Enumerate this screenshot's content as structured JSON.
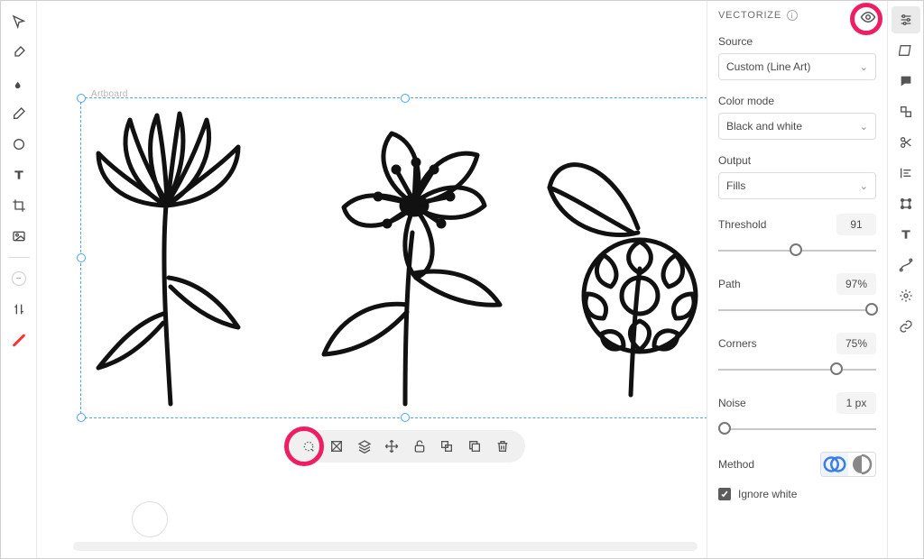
{
  "canvas": {
    "artboard_label": "Artboard"
  },
  "left_toolbar": {
    "tools": [
      "move-tool",
      "brush-tool",
      "fill-tool",
      "eraser-tool",
      "shape-tool",
      "text-tool",
      "crop-tool",
      "image-tool"
    ],
    "misc": [
      "minus-tool",
      "adjust-tool",
      "line-tool"
    ]
  },
  "context_bar": {
    "items": [
      "vectorize-action",
      "mask-action",
      "layers-action",
      "move-action",
      "unlock-action",
      "group-action",
      "duplicate-action",
      "delete-action"
    ]
  },
  "panel": {
    "title": "VECTORIZE",
    "source_label": "Source",
    "source_value": "Custom (Line Art)",
    "colormode_label": "Color mode",
    "colormode_value": "Black and white",
    "output_label": "Output",
    "output_value": "Fills",
    "threshold_label": "Threshold",
    "threshold_value": "91",
    "threshold_pct": 49,
    "path_label": "Path",
    "path_value": "97%",
    "path_pct": 97,
    "corners_label": "Corners",
    "corners_value": "75%",
    "corners_pct": 75,
    "noise_label": "Noise",
    "noise_value": "1 px",
    "noise_pct": 4,
    "method_label": "Method",
    "ignore_white_label": "Ignore white",
    "ignore_white_checked": true
  },
  "rail": {
    "items": [
      "settings-panel",
      "color-panel",
      "comments-panel",
      "components-panel",
      "scissors-panel",
      "align-panel",
      "transform-panel",
      "text-panel",
      "curve-panel",
      "gears-panel",
      "link-panel"
    ]
  },
  "highlights": [
    "context-vectorize-highlight",
    "preview-eye-highlight"
  ]
}
